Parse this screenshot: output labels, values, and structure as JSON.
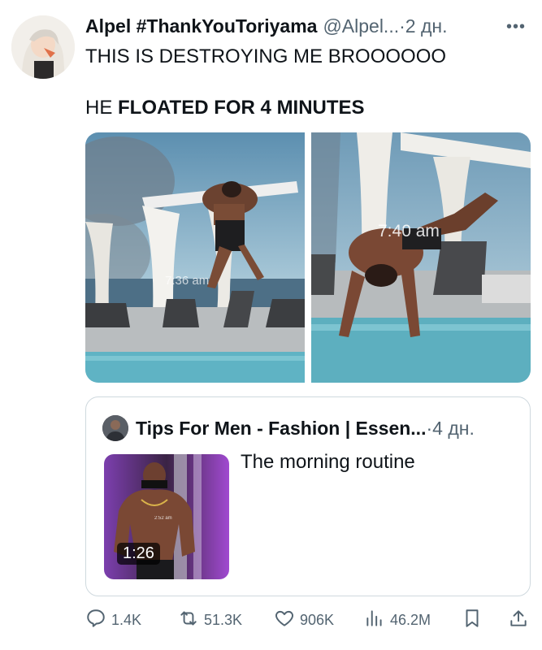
{
  "tweet": {
    "display_name": "Alpel #ThankYouToriyama",
    "handle": "@Alpel...",
    "separator": " · ",
    "time": "2 дн.",
    "more_icon": "more-horizontal-icon",
    "text_line1": "THIS IS DESTROYING ME BROOOOOO",
    "text_line2_prefix": "HE ",
    "text_line2_bold": "FLOATED FOR 4 MINUTES",
    "media": [
      {
        "kind": "photo",
        "timestamp": "7:36 am"
      },
      {
        "kind": "photo",
        "timestamp": "7:40 am"
      }
    ]
  },
  "quote": {
    "name": "Tips For Men - Fashion | Essen...",
    "separator": " · ",
    "time": "4 дн.",
    "text": "The morning routine",
    "video_duration": "1:26",
    "thumb_timestamp": "2:52 am"
  },
  "actions": {
    "replies": "1.4K",
    "retweets": "51.3K",
    "likes": "906K",
    "views": "46.2M"
  },
  "colors": {
    "text": "#0f1419",
    "secondary": "#536471",
    "border": "#cfd9de"
  }
}
